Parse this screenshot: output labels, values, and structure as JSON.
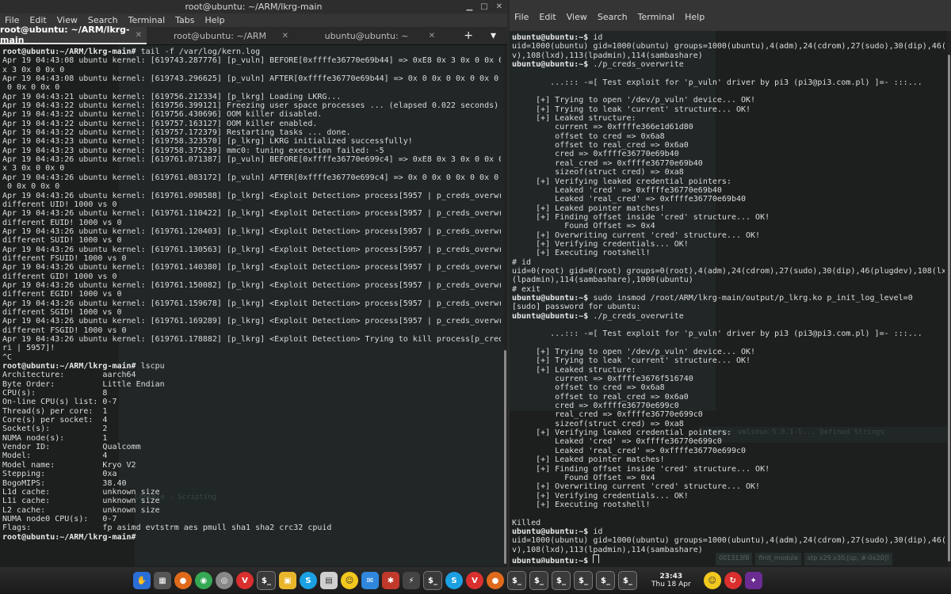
{
  "left_window": {
    "title": "root@ubuntu: ~/ARM/lkrg-main",
    "menu": [
      "File",
      "Edit",
      "View",
      "Search",
      "Terminal",
      "Tabs",
      "Help"
    ],
    "tabs": [
      "root@ubuntu: ~/ARM/lkrg-main",
      "root@ubuntu: ~/ARM",
      "ubuntu@ubuntu: ~"
    ],
    "lines": [
      "root@ubuntu:~/ARM/lkrg-main# tail -f /var/log/kern.log",
      "Apr 19 04:43:08 ubuntu kernel: [619743.287776] [p_vuln] BEFORE[0xffffe36770e69b44] => 0xE8 0x 3 0x 0 0x 0 0xE8 0",
      "x 3 0x 0 0x 0",
      "Apr 19 04:43:08 ubuntu kernel: [619743.296625] [p_vuln] AFTER[0xffffe36770e69b44] => 0x 0 0x 0 0x 0 0x 0 0x 0 0x",
      " 0 0x 0 0x 0",
      "Apr 19 04:43:21 ubuntu kernel: [619756.212334] [p_lkrg] Loading LKRG...",
      "Apr 19 04:43:22 ubuntu kernel: [619756.399121] Freezing user space processes ... (elapsed 0.022 seconds) done.",
      "Apr 19 04:43:22 ubuntu kernel: [619756.430696] OOM killer disabled.",
      "Apr 19 04:43:22 ubuntu kernel: [619757.163127] OOM killer enabled.",
      "Apr 19 04:43:22 ubuntu kernel: [619757.172379] Restarting tasks ... done.",
      "Apr 19 04:43:23 ubuntu kernel: [619758.323570] [p_lkrg] LKRG initialized successfully!",
      "Apr 19 04:43:23 ubuntu kernel: [619758.375239] mmc0: tuning execution failed: -5",
      "Apr 19 04:43:26 ubuntu kernel: [619761.071387] [p_vuln] BEFORE[0xffffe36770e699c4] => 0xE8 0x 3 0x 0 0x 0 0xE8 0",
      "x 3 0x 0 0x 0",
      "Apr 19 04:43:26 ubuntu kernel: [619761.083172] [p_vuln] AFTER[0xffffe36770e699c4] => 0x 0 0x 0 0x 0 0x 0 0x 0 0x",
      " 0 0x 0 0x 0",
      "Apr 19 04:43:26 ubuntu kernel: [619761.098588] [p_lkrg] <Exploit Detection> process[5957 | p_creds_overwri] has",
      "different UID! 1000 vs 0",
      "Apr 19 04:43:26 ubuntu kernel: [619761.110422] [p_lkrg] <Exploit Detection> process[5957 | p_creds_overwri] has",
      "different EUID! 1000 vs 0",
      "Apr 19 04:43:26 ubuntu kernel: [619761.120403] [p_lkrg] <Exploit Detection> process[5957 | p_creds_overwri] has",
      "different SUID! 1000 vs 0",
      "Apr 19 04:43:26 ubuntu kernel: [619761.130563] [p_lkrg] <Exploit Detection> process[5957 | p_creds_overwri] has",
      "different FSUID! 1000 vs 0",
      "Apr 19 04:43:26 ubuntu kernel: [619761.140380] [p_lkrg] <Exploit Detection> process[5957 | p_creds_overwri] has",
      "different GID! 1000 vs 0",
      "Apr 19 04:43:26 ubuntu kernel: [619761.150082] [p_lkrg] <Exploit Detection> process[5957 | p_creds_overwri] has",
      "different EGID! 1000 vs 0",
      "Apr 19 04:43:26 ubuntu kernel: [619761.159678] [p_lkrg] <Exploit Detection> process[5957 | p_creds_overwri] has",
      "different SGID! 1000 vs 0",
      "Apr 19 04:43:26 ubuntu kernel: [619761.169289] [p_lkrg] <Exploit Detection> process[5957 | p_creds_overwri] has",
      "different FSGID! 1000 vs 0",
      "Apr 19 04:43:26 ubuntu kernel: [619761.178882] [p_lkrg] <Exploit Detection> Trying to kill process[p_creds_overw",
      "ri | 5957]!",
      "^C",
      "root@ubuntu:~/ARM/lkrg-main# lscpu",
      "Architecture:        aarch64",
      "Byte Order:          Little Endian",
      "CPU(s):              8",
      "On-line CPU(s) list: 0-7",
      "Thread(s) per core:  1",
      "Core(s) per socket:  4",
      "Socket(s):           2",
      "NUMA node(s):        1",
      "Vendor ID:           Qualcomm",
      "Model:               4",
      "Model name:          Kryo V2",
      "Stepping:            0xa",
      "BogoMIPS:            38.40",
      "L1d cache:           unknown size",
      "L1i cache:           unknown size",
      "L2 cache:            unknown size",
      "NUMA node0 CPU(s):   0-7",
      "Flags:               fp asimd evtstrm aes pmull sha1 sha2 crc32 cpuid",
      "root@ubuntu:~/ARM/lkrg-main# "
    ]
  },
  "right_window": {
    "menu": [
      "File",
      "Edit",
      "View",
      "Search",
      "Terminal",
      "Help"
    ],
    "lines": [
      "ubuntu@ubuntu:~$ id",
      "uid=1000(ubuntu) gid=1000(ubuntu) groups=1000(ubuntu),4(adm),24(cdrom),27(sudo),30(dip),46(plugde",
      "v),108(lxd),113(lpadmin),114(sambashare)",
      "ubuntu@ubuntu:~$ ./p_creds_overwrite",
      "",
      "        ...::: -=[ Test exploit for 'p_vuln' driver by pi3 (pi3@pi3.com.pl) ]=- :::...",
      "",
      "     [+] Trying to open '/dev/p_vuln' device... OK!",
      "     [+] Trying to leak 'current' structure... OK!",
      "     [+] Leaked structure:",
      "         current => 0xffffe366e1d61d80",
      "         offset to cred => 0x6a8",
      "         offset to real_cred => 0x6a0",
      "         cred => 0xffffe36770e69b40",
      "         real_cred => 0xffffe36770e69b40",
      "         sizeof(struct cred) => 0xa8",
      "     [+] Verifying leaked credential pointers:",
      "         Leaked 'cred' => 0xffffe36770e69b40",
      "         Leaked 'real_cred' => 0xffffe36770e69b40",
      "     [+] Leaked pointer matches!",
      "     [+] Finding offset inside 'cred' structure... OK!",
      "           Found Offset => 0x4",
      "     [+] Overwriting current 'cred' structure... OK!",
      "     [+] Verifying credentials... OK!",
      "     [+] Executing rootshell!",
      "# id",
      "uid=0(root) gid=0(root) groups=0(root),4(adm),24(cdrom),27(sudo),30(dip),46(plugdev),108(lxd),113",
      "(lpadmin),114(sambashare),1000(ubuntu)",
      "# exit",
      "ubuntu@ubuntu:~$ sudo insmod /root/ARM/lkrg-main/output/p_lkrg.ko p_init_log_level=0",
      "[sudo] password for ubuntu:",
      "ubuntu@ubuntu:~$ ./p_creds_overwrite",
      "",
      "        ...::: -=[ Test exploit for 'p_vuln' driver by pi3 (pi3@pi3.com.pl) ]=- :::...",
      "",
      "     [+] Trying to open '/dev/p_vuln' device... OK!",
      "     [+] Trying to leak 'current' structure... OK!",
      "     [+] Leaked structure:",
      "         current => 0xffffe3676f516740",
      "         offset to cred => 0x6a8",
      "         offset to real_cred => 0x6a0",
      "         cred => 0xffffe36770e699c0",
      "         real_cred => 0xffffe36770e699c0",
      "         sizeof(struct cred) => 0xa8",
      "     [+] Verifying leaked credential pointers:",
      "         Leaked 'cred' => 0xffffe36770e699c0",
      "         Leaked 'real_cred' => 0xffffe36770e699c0",
      "     [+] Leaked pointer matches!",
      "     [+] Finding offset inside 'cred' structure... OK!",
      "           Found Offset => 0x4",
      "     [+] Overwriting current 'cred' structure... OK!",
      "     [+] Verifying credentials... OK!",
      "     [+] Executing rootshell!",
      "",
      "Killed",
      "ubuntu@ubuntu:~$ id",
      "uid=1000(ubuntu) gid=1000(ubuntu) groups=1000(ubuntu),4(adm),24(cdrom),27(sudo),30(dip),46(plugde",
      "v),108(lxd),113(lpadmin),114(sambashare)",
      "ubuntu@ubuntu:~$ "
    ]
  },
  "background_bits": {
    "status_tabs": [
      "Bytes: vmlinux-5.0.1-l...",
      "Defined Strings"
    ],
    "status_bottom": [
      "001313f8",
      "finit_module",
      "stp x29,x30,[sp, #-0x20]!"
    ],
    "console": "Console - Scripting"
  },
  "taskbar": {
    "clock_time": "23:43",
    "clock_date": "Thu 18 Apr"
  },
  "colors": {
    "terminal_bg": "#1d1f1f",
    "terminal_fg": "#dcdcdc",
    "chrome_bg": "#2d2d2d"
  }
}
